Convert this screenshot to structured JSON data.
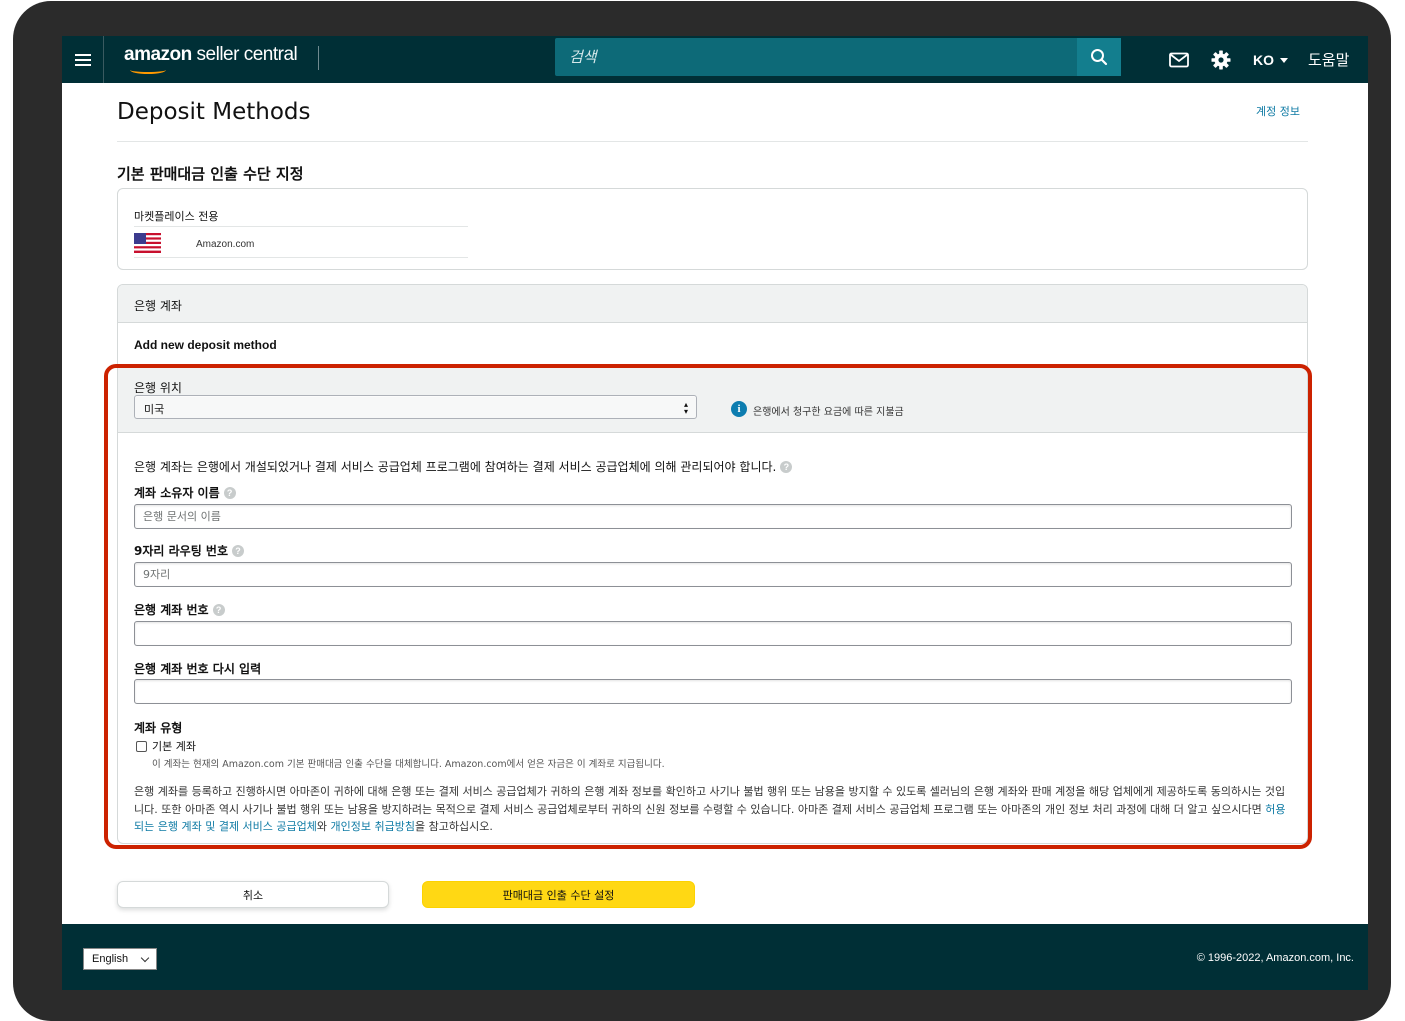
{
  "nav": {
    "logo_amazon": "amazon",
    "logo_rest": " seller central",
    "search_placeholder": "검색",
    "language": "KO",
    "help": "도움말"
  },
  "page": {
    "title": "Deposit Methods",
    "account_link": "계정 정보",
    "section_title": "기본 판매대금 인출 수단 지정"
  },
  "marketplace": {
    "label": "마켓플레이스 전용",
    "name": "Amazon.com"
  },
  "bank": {
    "header": "은행 계좌",
    "add_new": "Add new deposit method",
    "location_label": "은행 위치",
    "location_value": "미국",
    "location_info": "은행에서 청구한 요금에 따른 지불금",
    "notice": "은행 계좌는 은행에서 개설되었거나 결제 서비스 공급업체 프로그램에 참여하는 결제 서비스 공급업체에 의해 관리되어야 합니다.",
    "fields": {
      "holder_label": "계좌 소유자 이름",
      "holder_placeholder": "은행 문서의 이름",
      "routing_label": "9자리 라우팅 번호",
      "routing_placeholder": "9자리",
      "account_label": "은행 계좌 번호",
      "account_value": "",
      "account_confirm_label": "은행 계좌 번호 다시 입력",
      "account_confirm_value": ""
    },
    "account_type_label": "계좌 유형",
    "default_checkbox_label": "기본 계좌",
    "default_checkbox_checked": false,
    "default_checkbox_desc": "이 계좌는 현재의 Amazon.com 기본 판매대금 인출 수단을 대체합니다. Amazon.com에서 얻은 자금은 이 계좌로 지급됩니다.",
    "legal_text_1": "은행 계좌를 등록하고 진행하시면 아마존이 귀하에 대해 은행 또는 결제 서비스 공급업체가 귀하의 은행 계좌 정보를 확인하고 사기나 불법 행위 또는 남용을 방지할 수 있도록 셀러님의 은행 계좌와 판매 계정을 해당 업체에게 제공하도록 동의하시는 것입니다. 또한 아마존 역시 사기나 불법 행위 또는 남용을 방지하려는 목적으로 결제 서비스 공급업체로부터 귀하의 신원 정보를 수령할 수 있습니다. 아마존 결제 서비스 공급업체 프로그램 또는 아마존의 개인 정보 처리 과정에 대해 더 알고 싶으시다면 ",
    "legal_link_1": "허용되는 은행 계좌 및 결제 서비스 공급업체",
    "legal_text_2": "와 ",
    "legal_link_2": "개인정보 취급방침",
    "legal_text_3": "을 참고하십시오."
  },
  "actions": {
    "cancel": "취소",
    "submit": "판매대금 인출 수단 설정"
  },
  "footer": {
    "language": "English",
    "copyright": "© 1996-2022, Amazon.com, Inc."
  },
  "colors": {
    "nav_bg": "#002f36",
    "search_bg": "#0d6a78",
    "primary_button": "#ffd814",
    "highlight_border": "#cc2200",
    "link": "#0e7aa4"
  }
}
